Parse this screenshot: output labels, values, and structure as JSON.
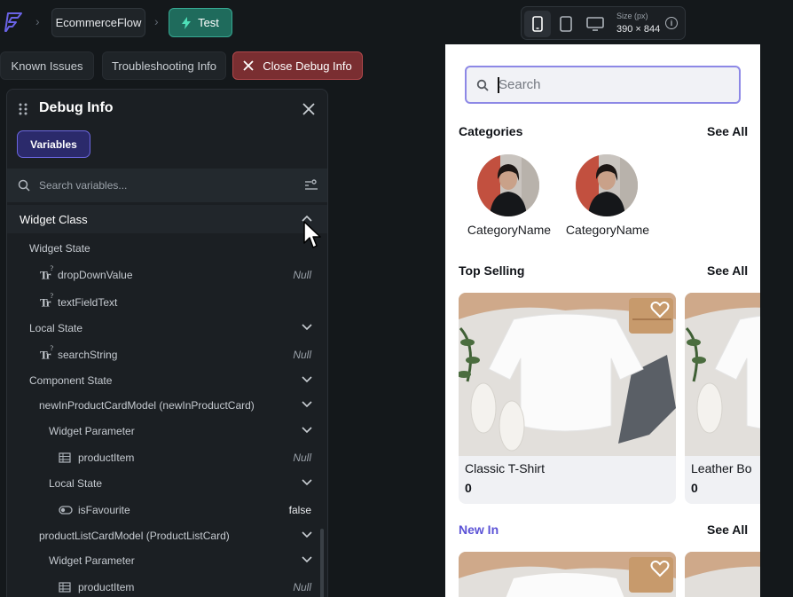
{
  "topbar": {
    "project_name": "EcommerceFlow",
    "test_label": "Test",
    "size_label": "Size (px)",
    "size_value": "390 × 844",
    "info_glyph": "i"
  },
  "tabs": {
    "known_issues": "Known Issues",
    "troubleshooting": "Troubleshooting Info",
    "close_debug": "Close Debug Info"
  },
  "debug": {
    "title": "Debug Info",
    "variables_chip": "Variables",
    "search_placeholder": "Search variables...",
    "class_label": "Widget Class",
    "rows": [
      {
        "label": "Widget State"
      },
      {
        "label": "dropDownValue",
        "value": "Null",
        "type_glyph": "Tr"
      },
      {
        "label": "textFieldText",
        "type_glyph": "Tr"
      },
      {
        "label": "Local State"
      },
      {
        "label": "searchString",
        "value": "Null",
        "type_glyph": "Tr"
      },
      {
        "label": "Component State"
      },
      {
        "label": "newInProductCardModel (newInProductCard)"
      },
      {
        "label": "Widget Parameter"
      },
      {
        "label": "productItem",
        "value": "Null"
      },
      {
        "label": "Local State"
      },
      {
        "label": "isFavourite",
        "value": "false"
      },
      {
        "label": "productListCardModel (ProductListCard)"
      },
      {
        "label": "Widget Parameter"
      },
      {
        "label": "productItem",
        "value": "Null"
      }
    ]
  },
  "phone": {
    "search_placeholder": "Search",
    "categories_title": "Categories",
    "see_all": "See All",
    "category_names": [
      "CategoryName",
      "CategoryName"
    ],
    "top_selling_title": "Top Selling",
    "products": [
      {
        "title": "Classic T-Shirt",
        "price": "0"
      },
      {
        "title": "Leather Bo",
        "price": "0"
      }
    ],
    "new_in_title": "New In"
  },
  "icons": {
    "logo": "flutterflow-logo-icon",
    "test": "lightning-icon",
    "close": "close-icon",
    "search": "search-icon",
    "filter": "filter-icon",
    "chevron": "chevron-down-icon",
    "heart": "heart-icon"
  },
  "colors": {
    "accent": "#5b52d6",
    "test_green": "#1f6b5c",
    "close_red": "#7a2e31"
  }
}
